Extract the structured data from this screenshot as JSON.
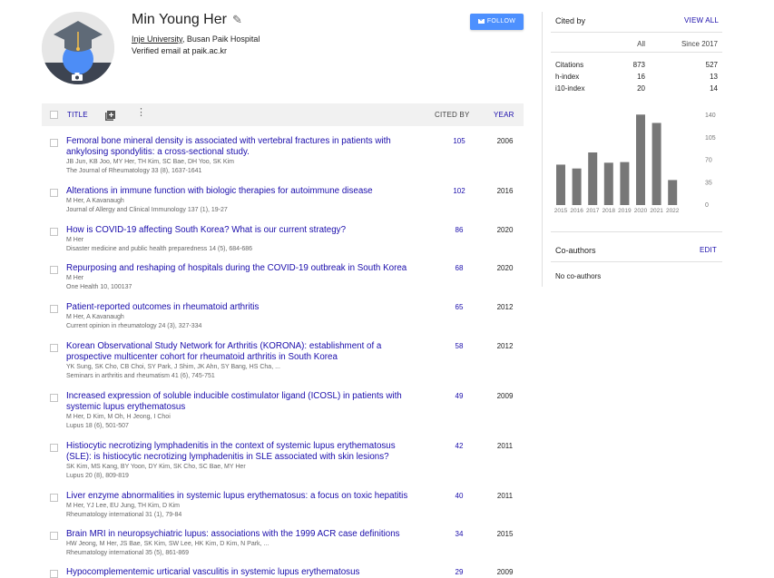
{
  "profile": {
    "name": "Min Young Her",
    "affiliation_link": "Inje University",
    "affiliation_rest": ", Busan Paik Hospital",
    "email": "Verified email at paik.ac.kr",
    "follow_label": "FOLLOW"
  },
  "table": {
    "title_header": "TITLE",
    "cited_header": "CITED BY",
    "year_header": "YEAR",
    "articles": [
      {
        "title": "Femoral bone mineral density is associated with vertebral fractures in patients with ankylosing spondylitis: a cross-sectional study.",
        "authors": "JB Jun, KB Joo, MY Her, TH Kim, SC Bae, DH Yoo, SK Kim",
        "venue": "The Journal of Rheumatology 33 (8), 1637-1641",
        "cited": "105",
        "year": "2006"
      },
      {
        "title": "Alterations in immune function with biologic therapies for autoimmune disease",
        "authors": "M Her, A Kavanaugh",
        "venue": "Journal of Allergy and Clinical Immunology 137 (1), 19-27",
        "cited": "102",
        "year": "2016"
      },
      {
        "title": "How is COVID-19 affecting South Korea? What is our current strategy?",
        "authors": "M Her",
        "venue": "Disaster medicine and public health preparedness 14 (5), 684-686",
        "cited": "86",
        "year": "2020"
      },
      {
        "title": "Repurposing and reshaping of hospitals during the COVID-19 outbreak in South Korea",
        "authors": "M Her",
        "venue": "One Health 10, 100137",
        "cited": "68",
        "year": "2020"
      },
      {
        "title": "Patient-reported outcomes in rheumatoid arthritis",
        "authors": "M Her, A Kavanaugh",
        "venue": "Current opinion in rheumatology 24 (3), 327-334",
        "cited": "65",
        "year": "2012"
      },
      {
        "title": "Korean Observational Study Network for Arthritis (KORONA): establishment of a prospective multicenter cohort for rheumatoid arthritis in South Korea",
        "authors": "YK Sung, SK Cho, CB Choi, SY Park, J Shim, JK Ahn, SY Bang, HS Cha, ...",
        "venue": "Seminars in arthritis and rheumatism 41 (6), 745-751",
        "cited": "58",
        "year": "2012"
      },
      {
        "title": "Increased expression of soluble inducible costimulator ligand (ICOSL) in patients with systemic lupus erythematosus",
        "authors": "M Her, D Kim, M Oh, H Jeong, I Choi",
        "venue": "Lupus 18 (6), 501-507",
        "cited": "49",
        "year": "2009"
      },
      {
        "title": "Histiocytic necrotizing lymphadenitis in the context of systemic lupus erythematosus (SLE): is histiocytic necrotizing lymphadenitis in SLE associated with skin lesions?",
        "authors": "SK Kim, MS Kang, BY Yoon, DY Kim, SK Cho, SC Bae, MY Her",
        "venue": "Lupus 20 (8), 809-819",
        "cited": "42",
        "year": "2011"
      },
      {
        "title": "Liver enzyme abnormalities in systemic lupus erythematosus: a focus on toxic hepatitis",
        "authors": "M Her, YJ Lee, EU Jung, TH Kim, D Kim",
        "venue": "Rheumatology international 31 (1), 79-84",
        "cited": "40",
        "year": "2011"
      },
      {
        "title": "Brain MRI in neuropsychiatric lupus: associations with the 1999 ACR case definitions",
        "authors": "HW Jeong, M Her, JS Bae, SK Kim, SW Lee, HK Kim, D Kim, N Park, ...",
        "venue": "Rheumatology international 35 (5), 861-869",
        "cited": "34",
        "year": "2015"
      },
      {
        "title": "Hypocomplementemic urticarial vasculitis in systemic lupus erythematosus",
        "authors": "",
        "venue": "",
        "cited": "29",
        "year": "2009"
      }
    ]
  },
  "cited_by": {
    "title": "Cited by",
    "view_all": "VIEW ALL",
    "col_all": "All",
    "col_since": "Since 2017",
    "rows": [
      {
        "label": "Citations",
        "all": "873",
        "since": "527"
      },
      {
        "label": "h-index",
        "all": "16",
        "since": "13"
      },
      {
        "label": "i10-index",
        "all": "20",
        "since": "14"
      }
    ]
  },
  "chart_data": {
    "type": "bar",
    "categories": [
      "2015",
      "2016",
      "2017",
      "2018",
      "2019",
      "2020",
      "2021",
      "2022"
    ],
    "values": [
      63,
      57,
      82,
      66,
      67,
      141,
      128,
      39
    ],
    "ylim": [
      0,
      140
    ],
    "yticks": [
      "140",
      "105",
      "70",
      "35",
      "0"
    ],
    "bar_color": "#777777"
  },
  "coauthors": {
    "title": "Co-authors",
    "edit": "EDIT",
    "empty": "No co-authors"
  },
  "colors": {
    "link": "#1a0dab",
    "follow_button": "#4d90fe",
    "header_bg": "#f1f1f1"
  }
}
